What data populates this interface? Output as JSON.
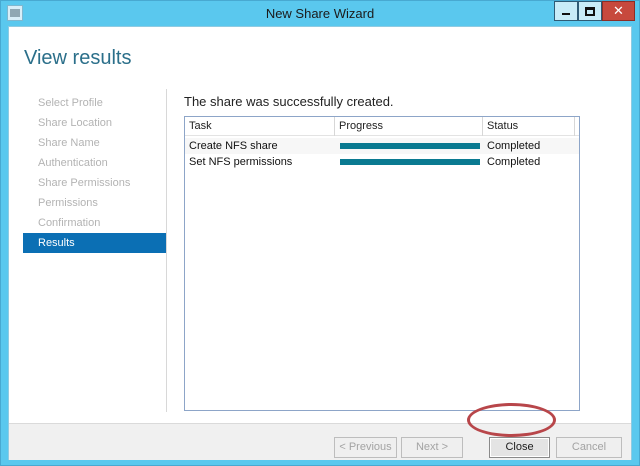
{
  "window": {
    "title": "New Share Wizard"
  },
  "page": {
    "title": "View results",
    "message": "The share was successfully created."
  },
  "steps": [
    {
      "label": "Select Profile",
      "active": false
    },
    {
      "label": "Share Location",
      "active": false
    },
    {
      "label": "Share Name",
      "active": false
    },
    {
      "label": "Authentication",
      "active": false
    },
    {
      "label": "Share Permissions",
      "active": false
    },
    {
      "label": "Permissions",
      "active": false
    },
    {
      "label": "Confirmation",
      "active": false
    },
    {
      "label": "Results",
      "active": true
    }
  ],
  "grid": {
    "columns": [
      "Task",
      "Progress",
      "Status"
    ],
    "rows": [
      {
        "task": "Create NFS share",
        "progress": 100,
        "status": "Completed"
      },
      {
        "task": "Set NFS permissions",
        "progress": 100,
        "status": "Completed"
      }
    ]
  },
  "buttons": {
    "previous": "< Previous",
    "next": "Next >",
    "close": "Close",
    "cancel": "Cancel"
  },
  "colors": {
    "accent": "#0b6fb4",
    "progress": "#0a7a91",
    "titlebar": "#5ac8ee",
    "highlight_ring": "#b8464a"
  },
  "icons": {
    "app": "wizard-window-icon",
    "minimize": "minimize-icon",
    "maximize": "maximize-icon",
    "close": "close-icon"
  }
}
